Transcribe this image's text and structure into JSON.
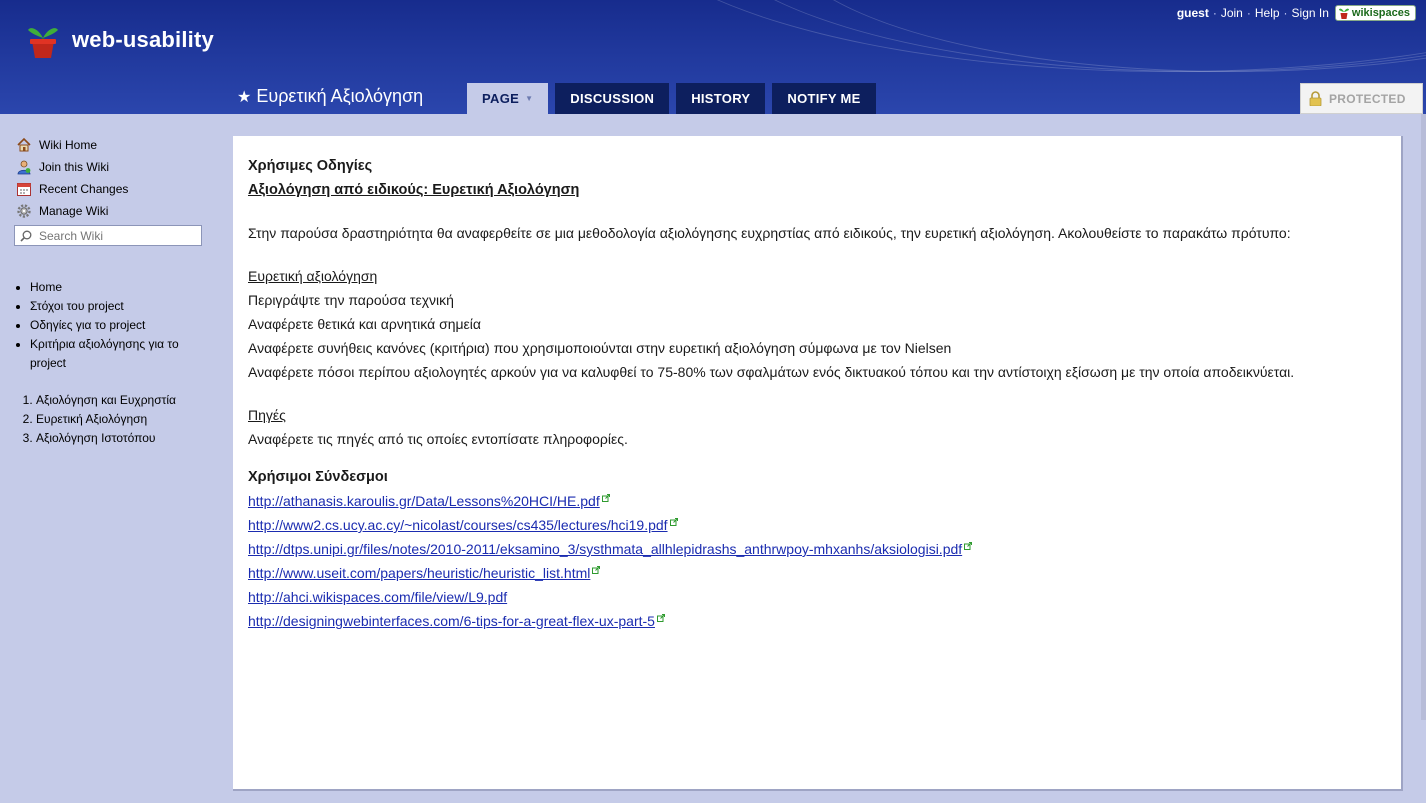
{
  "header": {
    "site_title": "web-usability",
    "userbar": {
      "guest": "guest",
      "join": "Join",
      "help": "Help",
      "sign_in": "Sign In",
      "badge": "wikispaces"
    }
  },
  "page": {
    "title": "Ευρετική Αξιολόγηση",
    "tabs": [
      {
        "label": "PAGE",
        "active": true
      },
      {
        "label": "DISCUSSION",
        "active": false
      },
      {
        "label": "HISTORY",
        "active": false
      },
      {
        "label": "NOTIFY ME",
        "active": false
      }
    ],
    "protected_label": "PROTECTED"
  },
  "sidebar": {
    "nav": [
      {
        "label": "Wiki Home",
        "icon": "house-icon"
      },
      {
        "label": "Join this Wiki",
        "icon": "user-icon"
      },
      {
        "label": "Recent Changes",
        "icon": "calendar-icon"
      },
      {
        "label": "Manage Wiki",
        "icon": "gear-icon"
      }
    ],
    "search_placeholder": "Search Wiki",
    "links": [
      "Home",
      "Στόχοι του project",
      "Οδηγίες για το project",
      "Κριτήρια αξιολόγησης για το project"
    ],
    "numbered": [
      "Αξιολόγηση και Ευχρηστία",
      "Ευρετική Αξιολόγηση",
      "Αξιολόγηση Ιστοτόπου"
    ]
  },
  "content": {
    "heading": "Χρήσιμες Οδηγίες",
    "subheading": "Αξιολόγηση από ειδικούς: Ευρετική Αξιολόγηση",
    "intro": "Στην παρούσα δραστηριότητα θα αναφερθείτε σε μια μεθοδολογία αξιολόγησης ευχρηστίας από ειδικούς, την ευρετική αξιολόγηση. Ακολουθείστε το παρακάτω πρότυπο:",
    "section1_title": "Ευρετική αξιολόγηση",
    "section1_lines": [
      "Περιγράψτε την παρούσα τεχνική",
      "Αναφέρετε θετικά και αρνητικά σημεία",
      "Αναφέρετε συνήθεις κανόνες (κριτήρια) που χρησιμοποιούνται στην ευρετική αξιολόγηση σύμφωνα με τον Nielsen",
      "Αναφέρετε πόσοι περίπου αξιολογητές αρκούν για να καλυφθεί το 75-80% των σφαλμάτων ενός δικτυακού τόπου και την αντίστοιχη εξίσωση με την οποία αποδεικνύεται."
    ],
    "section2_title": "Πηγές",
    "section2_line": "Αναφέρετε τις πηγές από τις οποίες εντοπίσατε πληροφορίες.",
    "links_title": "Χρήσιμοι Σύνδεσμοι",
    "links": [
      {
        "text": "http://athanasis.karoulis.gr/Data/Lessons%20HCI/HE.pdf",
        "external": true
      },
      {
        "text": "http://www2.cs.ucy.ac.cy/~nicolast/courses/cs435/lectures/hci19.pdf",
        "external": true
      },
      {
        "text": "http://dtps.unipi.gr/files/notes/2010-2011/eksamino_3/systhmata_allhlepidrashs_anthrwpoy-mhxanhs/aksiologisi.pdf",
        "external": true
      },
      {
        "text": "http://www.useit.com/papers/heuristic/heuristic_list.html",
        "external": true
      },
      {
        "text": "http://ahci.wikispaces.com/file/view/L9.pdf",
        "external": false
      },
      {
        "text": "http://designingwebinterfaces.com/6-tips-for-a-great-flex-ux-part-5",
        "external": true
      }
    ]
  },
  "colors": {
    "header_bg": "#1f3699",
    "tab_bg": "#0d1f5e",
    "sidebar_bg": "#c5cbe8",
    "link": "#1b2cb0"
  }
}
